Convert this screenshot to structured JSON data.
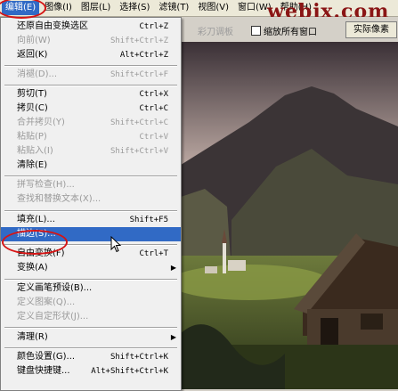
{
  "menubar": {
    "items": [
      {
        "label": "编辑(E)",
        "active": true
      },
      {
        "label": "图像(I)"
      },
      {
        "label": "图层(L)"
      },
      {
        "label": "选择(S)"
      },
      {
        "label": "滤镜(T)"
      },
      {
        "label": "视图(V)"
      },
      {
        "label": "窗口(W)"
      },
      {
        "label": "帮助(H)"
      }
    ]
  },
  "watermark": "webjx.com",
  "options_bar": {
    "palette_label": "彩刀调板",
    "resize_all_windows": "缩放所有窗口",
    "actual_pixels_button": "实际像素"
  },
  "edit_menu": {
    "items": [
      {
        "label": "还原自由变换选区",
        "shortcut": "Ctrl+Z"
      },
      {
        "label": "向前(W)",
        "shortcut": "Shift+Ctrl+Z",
        "disabled": true
      },
      {
        "label": "返回(K)",
        "shortcut": "Alt+Ctrl+Z"
      },
      {
        "label": "消褪(D)...",
        "shortcut": "Shift+Ctrl+F",
        "disabled": true
      },
      {
        "label": "剪切(T)",
        "shortcut": "Ctrl+X"
      },
      {
        "label": "拷贝(C)",
        "shortcut": "Ctrl+C"
      },
      {
        "label": "合并拷贝(Y)",
        "shortcut": "Shift+Ctrl+C",
        "disabled": true
      },
      {
        "label": "粘贴(P)",
        "shortcut": "Ctrl+V",
        "disabled": true
      },
      {
        "label": "粘贴入(I)",
        "shortcut": "Shift+Ctrl+V",
        "disabled": true
      },
      {
        "label": "清除(E)"
      },
      {
        "label": "拼写检查(H)...",
        "disabled": true
      },
      {
        "label": "查找和替换文本(X)...",
        "disabled": true
      },
      {
        "label": "填充(L)...",
        "shortcut": "Shift+F5"
      },
      {
        "label": "描边(S)...",
        "highlighted": true
      },
      {
        "label": "自由变换(F)",
        "shortcut": "Ctrl+T"
      },
      {
        "label": "变换(A)",
        "submenu": true
      },
      {
        "label": "定义画笔预设(B)..."
      },
      {
        "label": "定义图案(Q)...",
        "disabled": true
      },
      {
        "label": "定义自定形状(J)...",
        "disabled": true
      },
      {
        "label": "清理(R)",
        "submenu": true
      },
      {
        "label": "颜色设置(G)...",
        "shortcut": "Shift+Ctrl+K"
      },
      {
        "label": "键盘快捷键...",
        "shortcut": "Alt+Shift+Ctrl+K"
      }
    ]
  },
  "colors": {
    "menu_highlight": "#316ac5",
    "annotation_red": "#d61414",
    "disabled_text": "#9a9a9a"
  }
}
